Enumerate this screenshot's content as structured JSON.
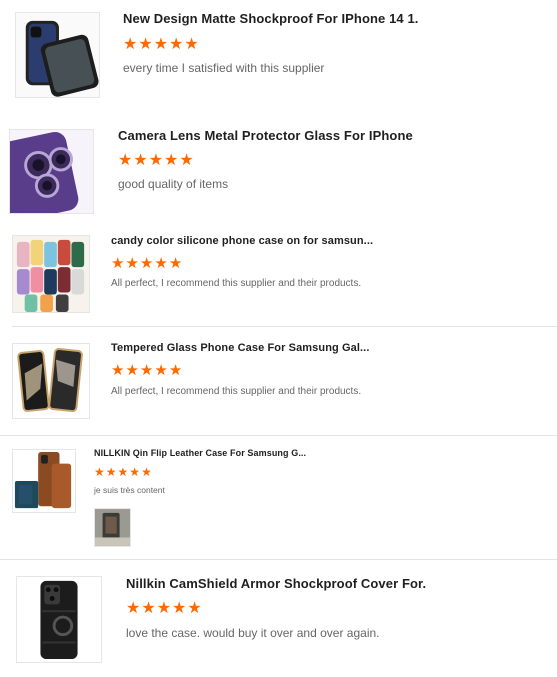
{
  "star_color": "#ff6a00",
  "reviews": [
    {
      "title": "New Design Matte Shockproof For IPhone 14 1...",
      "rating": 5,
      "comment": "every time I satisfied with this supplier",
      "thumbnail": "phone-case-matte-black-image"
    },
    {
      "title": "Camera Lens Metal Protector Glass For IPhone...",
      "rating": 5,
      "comment": "good quality of items",
      "thumbnail": "purple-camera-lens-protector-image"
    },
    {
      "title": "candy color silicone phone case on for samsun...",
      "rating": 5,
      "comment": "All perfect, I recommend this supplier and their products.",
      "thumbnail": "colorful-silicone-cases-image"
    },
    {
      "title": "Tempered Glass Phone Case For Samsung Gal...",
      "rating": 5,
      "comment": "All perfect, I recommend this supplier and their products.",
      "thumbnail": "foldable-glass-case-image"
    },
    {
      "title": "NILLKIN Qin Flip Leather Case For Samsung G...",
      "rating": 5,
      "comment": "je suis très content",
      "thumbnail": "brown-leather-flip-case-image",
      "review_photo": "customer-review-photo"
    },
    {
      "title": "Nillkin CamShield Armor Shockproof Cover For...",
      "rating": 5,
      "comment": "love the case. would buy it over and over again.",
      "thumbnail": "black-armor-case-image"
    }
  ]
}
